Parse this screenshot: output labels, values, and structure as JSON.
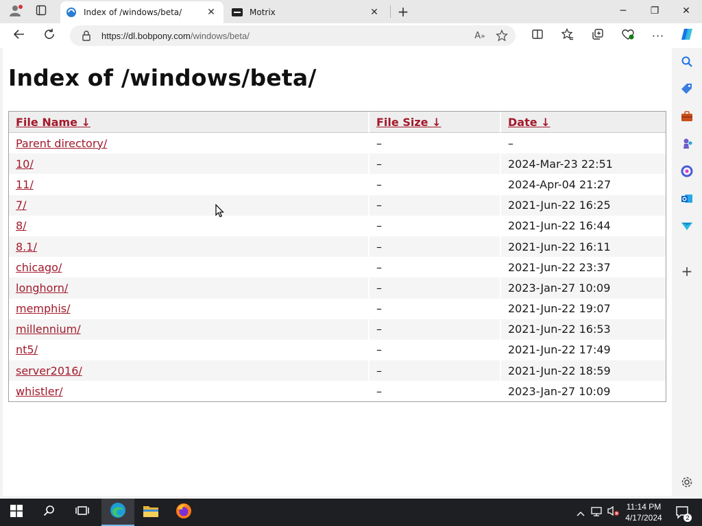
{
  "browser": {
    "tabs": [
      {
        "title": "Index of /windows/beta/",
        "active": true,
        "icon": "page-icon"
      },
      {
        "title": "Motrix",
        "active": false,
        "icon": "motrix-icon"
      }
    ],
    "url_host": "https://dl.bobpony.com",
    "url_path": "/windows/beta/"
  },
  "page": {
    "title": "Index of /windows/beta/",
    "headers": {
      "name": "File Name",
      "size": "File Size",
      "date": "Date",
      "sort_glyph": "↓"
    },
    "rows": [
      {
        "name": "Parent directory/",
        "size": "–",
        "date": "–"
      },
      {
        "name": "10/",
        "size": "–",
        "date": "2024-Mar-23 22:51"
      },
      {
        "name": "11/",
        "size": "–",
        "date": "2024-Apr-04 21:27"
      },
      {
        "name": "7/",
        "size": "–",
        "date": "2021-Jun-22 16:25"
      },
      {
        "name": "8/",
        "size": "–",
        "date": "2021-Jun-22 16:44"
      },
      {
        "name": "8.1/",
        "size": "–",
        "date": "2021-Jun-22 16:11"
      },
      {
        "name": "chicago/",
        "size": "–",
        "date": "2021-Jun-22 23:37"
      },
      {
        "name": "longhorn/",
        "size": "–",
        "date": "2023-Jan-27 10:09"
      },
      {
        "name": "memphis/",
        "size": "–",
        "date": "2021-Jun-22 19:07"
      },
      {
        "name": "millennium/",
        "size": "–",
        "date": "2021-Jun-22 16:53"
      },
      {
        "name": "nt5/",
        "size": "–",
        "date": "2021-Jun-22 17:49"
      },
      {
        "name": "server2016/",
        "size": "–",
        "date": "2021-Jun-22 18:59"
      },
      {
        "name": "whistler/",
        "size": "–",
        "date": "2023-Jan-27 10:09"
      }
    ]
  },
  "taskbar": {
    "time": "11:14 PM",
    "date": "4/17/2024",
    "notification_count": "2"
  },
  "colors": {
    "link": "#a2192b",
    "taskbar": "#1e1f23",
    "active_indicator": "#76b9ed"
  }
}
